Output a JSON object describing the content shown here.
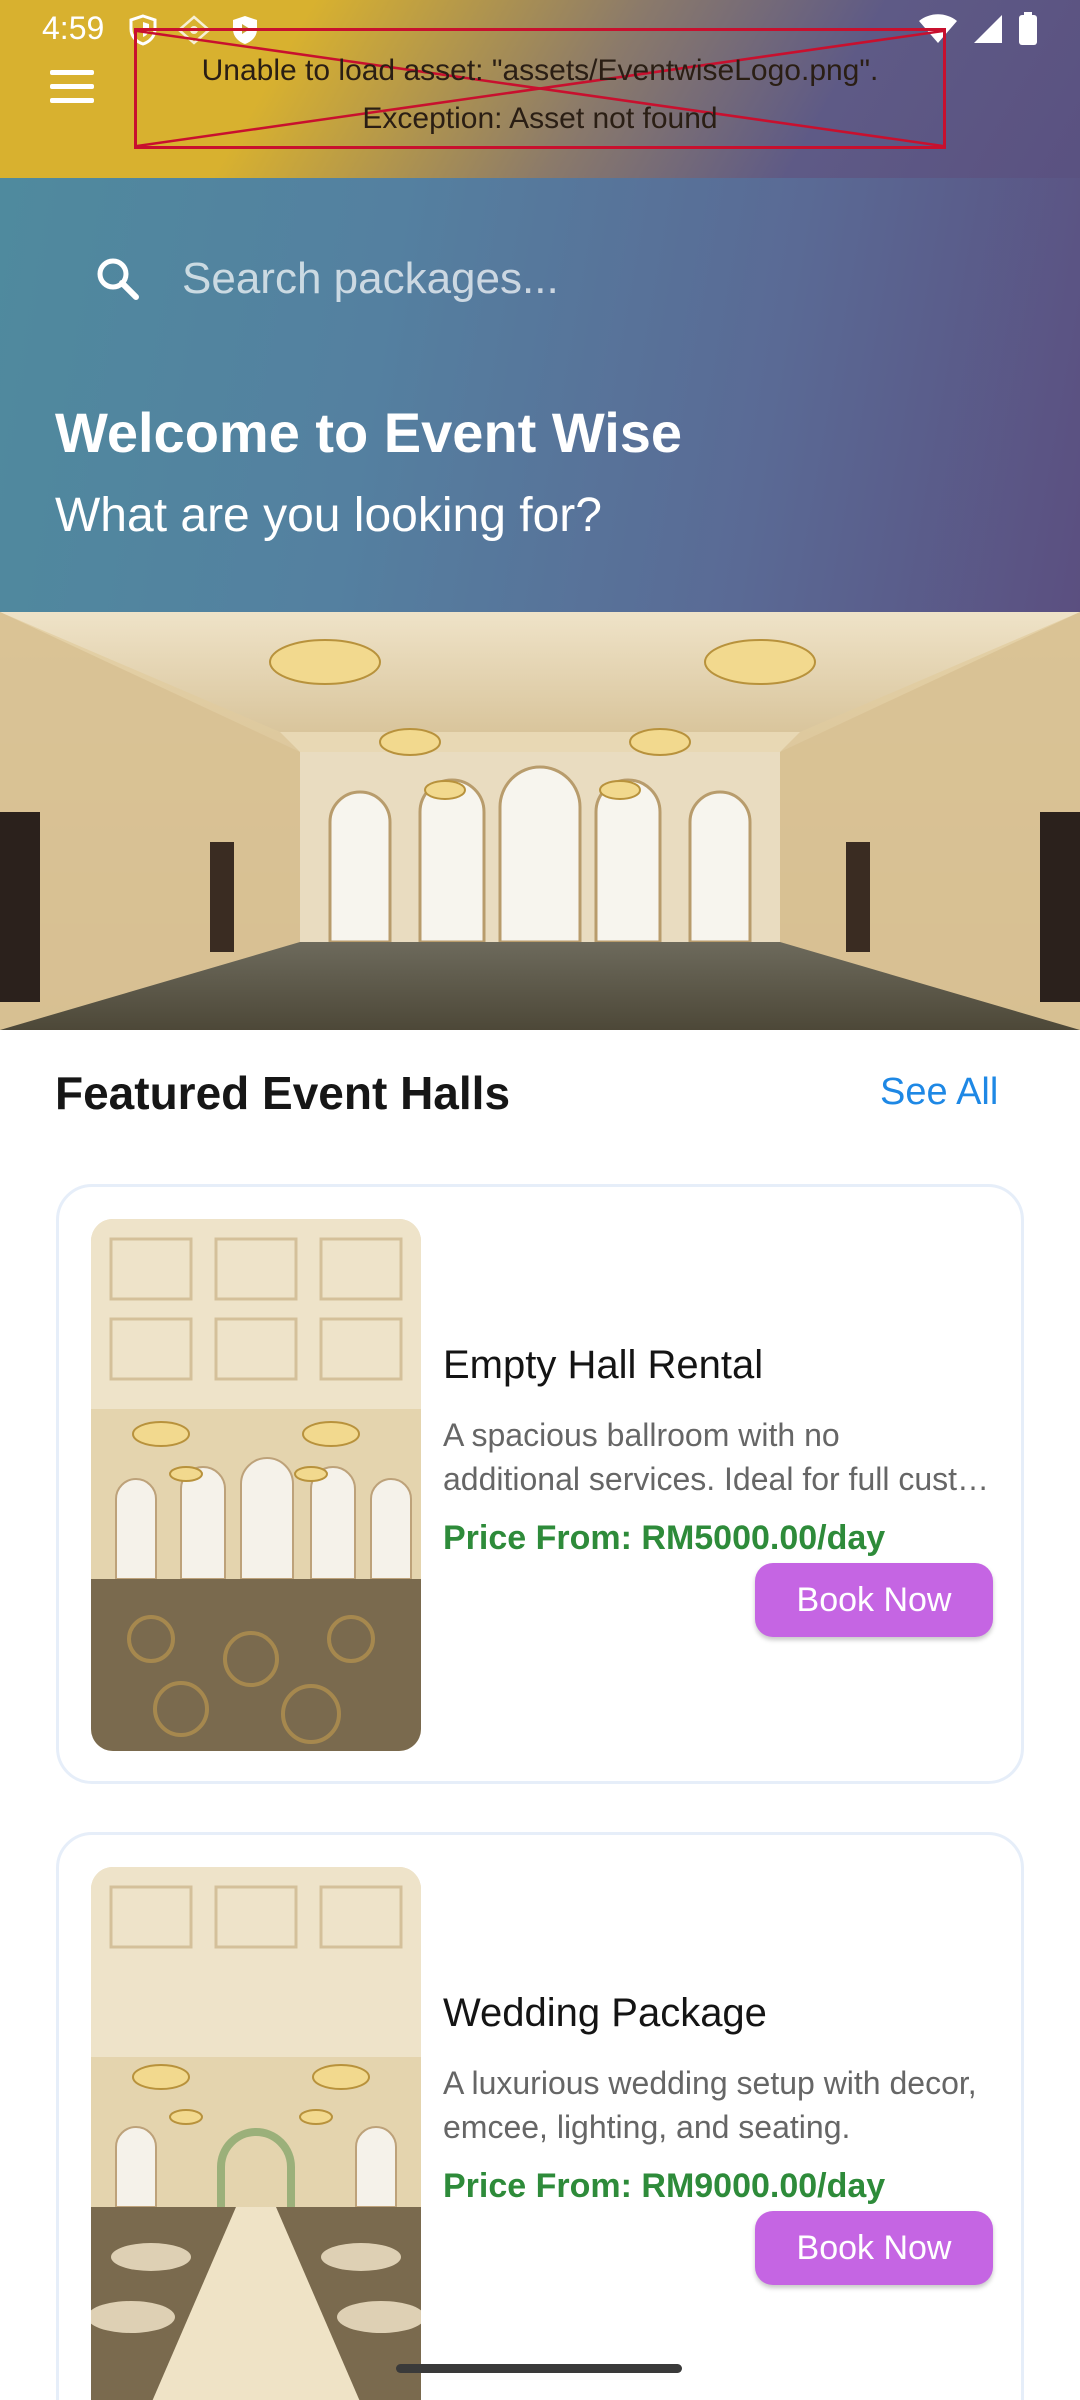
{
  "status_bar": {
    "time": "4:59"
  },
  "header": {
    "logo_error_line1": "Unable to load asset: \"assets/EventwiseLogo.png\".",
    "logo_error_line2": "Exception: Asset not found"
  },
  "search": {
    "placeholder": "Search packages..."
  },
  "welcome": {
    "title": "Welcome to Event Wise",
    "subtitle": "What are you looking for?"
  },
  "featured": {
    "title": "Featured Event Halls",
    "see_all": "See All",
    "items": [
      {
        "title": "Empty Hall Rental",
        "desc_line1": "A spacious ballroom with no",
        "desc_line2": "additional services. Ideal for full custom...",
        "price": "Price From: RM5000.00/day",
        "button": "Book Now"
      },
      {
        "title": "Wedding Package",
        "desc_line1": "A luxurious wedding setup with decor,",
        "desc_line2": "emcee, lighting, and seating.",
        "price": "Price From: RM9000.00/day",
        "button": "Book Now"
      }
    ]
  },
  "colors": {
    "accent_button": "#c565e3",
    "price_green": "#2e8b3a",
    "link_blue": "#1e88e5"
  }
}
